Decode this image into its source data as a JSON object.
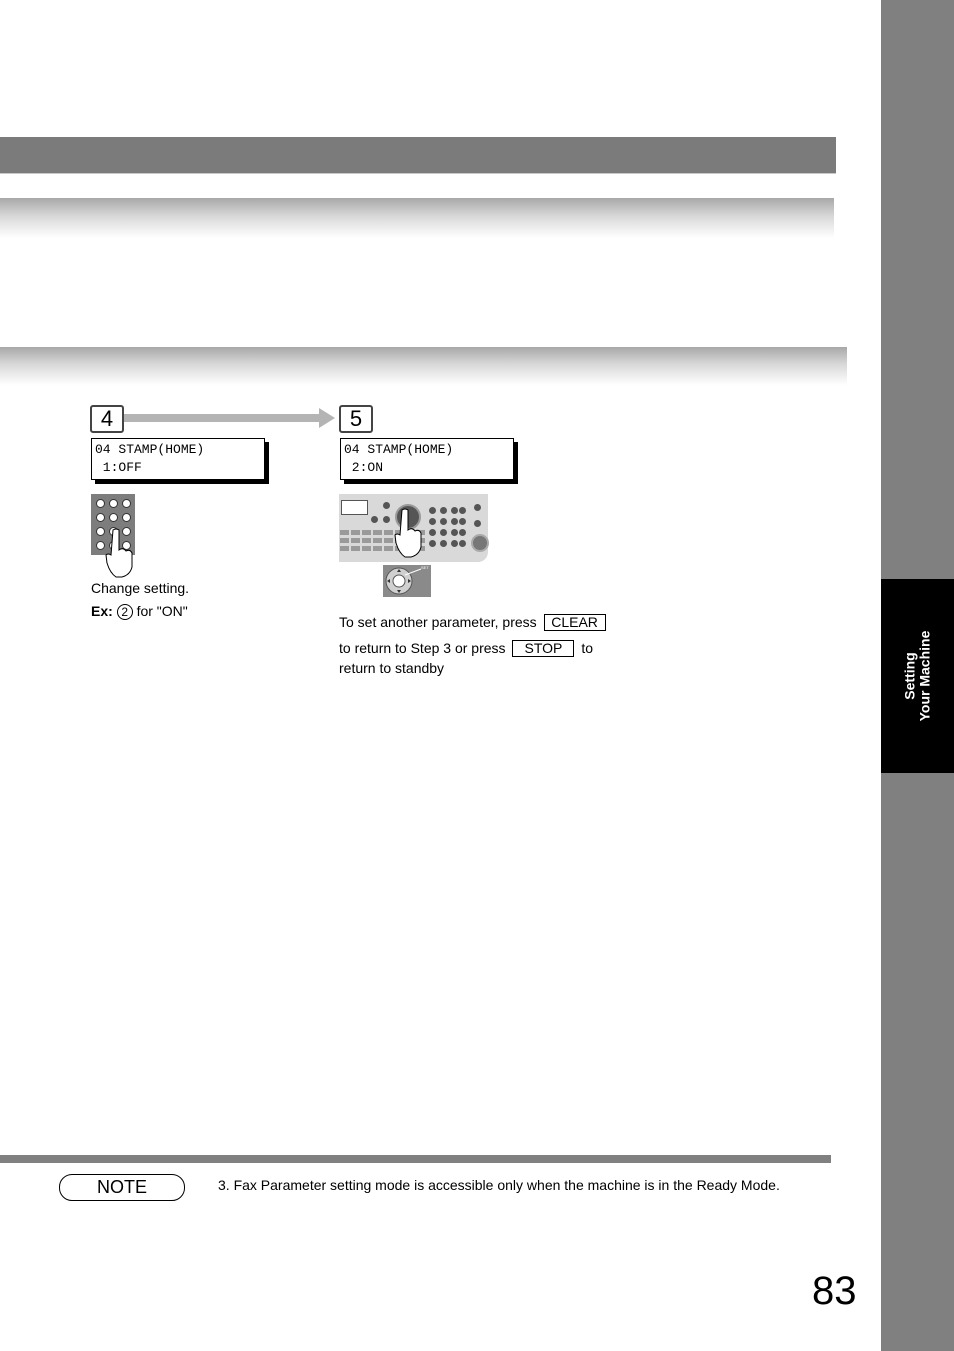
{
  "side_tab": {
    "line1": "Setting",
    "line2": "Your Machine"
  },
  "steps": [
    {
      "number": "4",
      "display": {
        "line1": "04 STAMP(HOME)",
        "line2": " 1:OFF"
      },
      "instruction": "Change setting.",
      "example": {
        "label": "Ex:",
        "key": "2",
        "suffix": "for \"ON\""
      }
    },
    {
      "number": "5",
      "display": {
        "line1": "04 STAMP(HOME)",
        "line2": " 2:ON"
      },
      "text_part1": "To set another parameter, press",
      "key1": "CLEAR",
      "text_part2": "to return to Step 3 or press",
      "key2": "STOP",
      "text_part3": "to",
      "text_part4": "return to standby",
      "nav_label": "SET"
    }
  ],
  "note": {
    "label": "NOTE",
    "text": "3.  Fax Parameter setting mode is accessible only when the machine is in the Ready Mode."
  },
  "page_number": "83"
}
